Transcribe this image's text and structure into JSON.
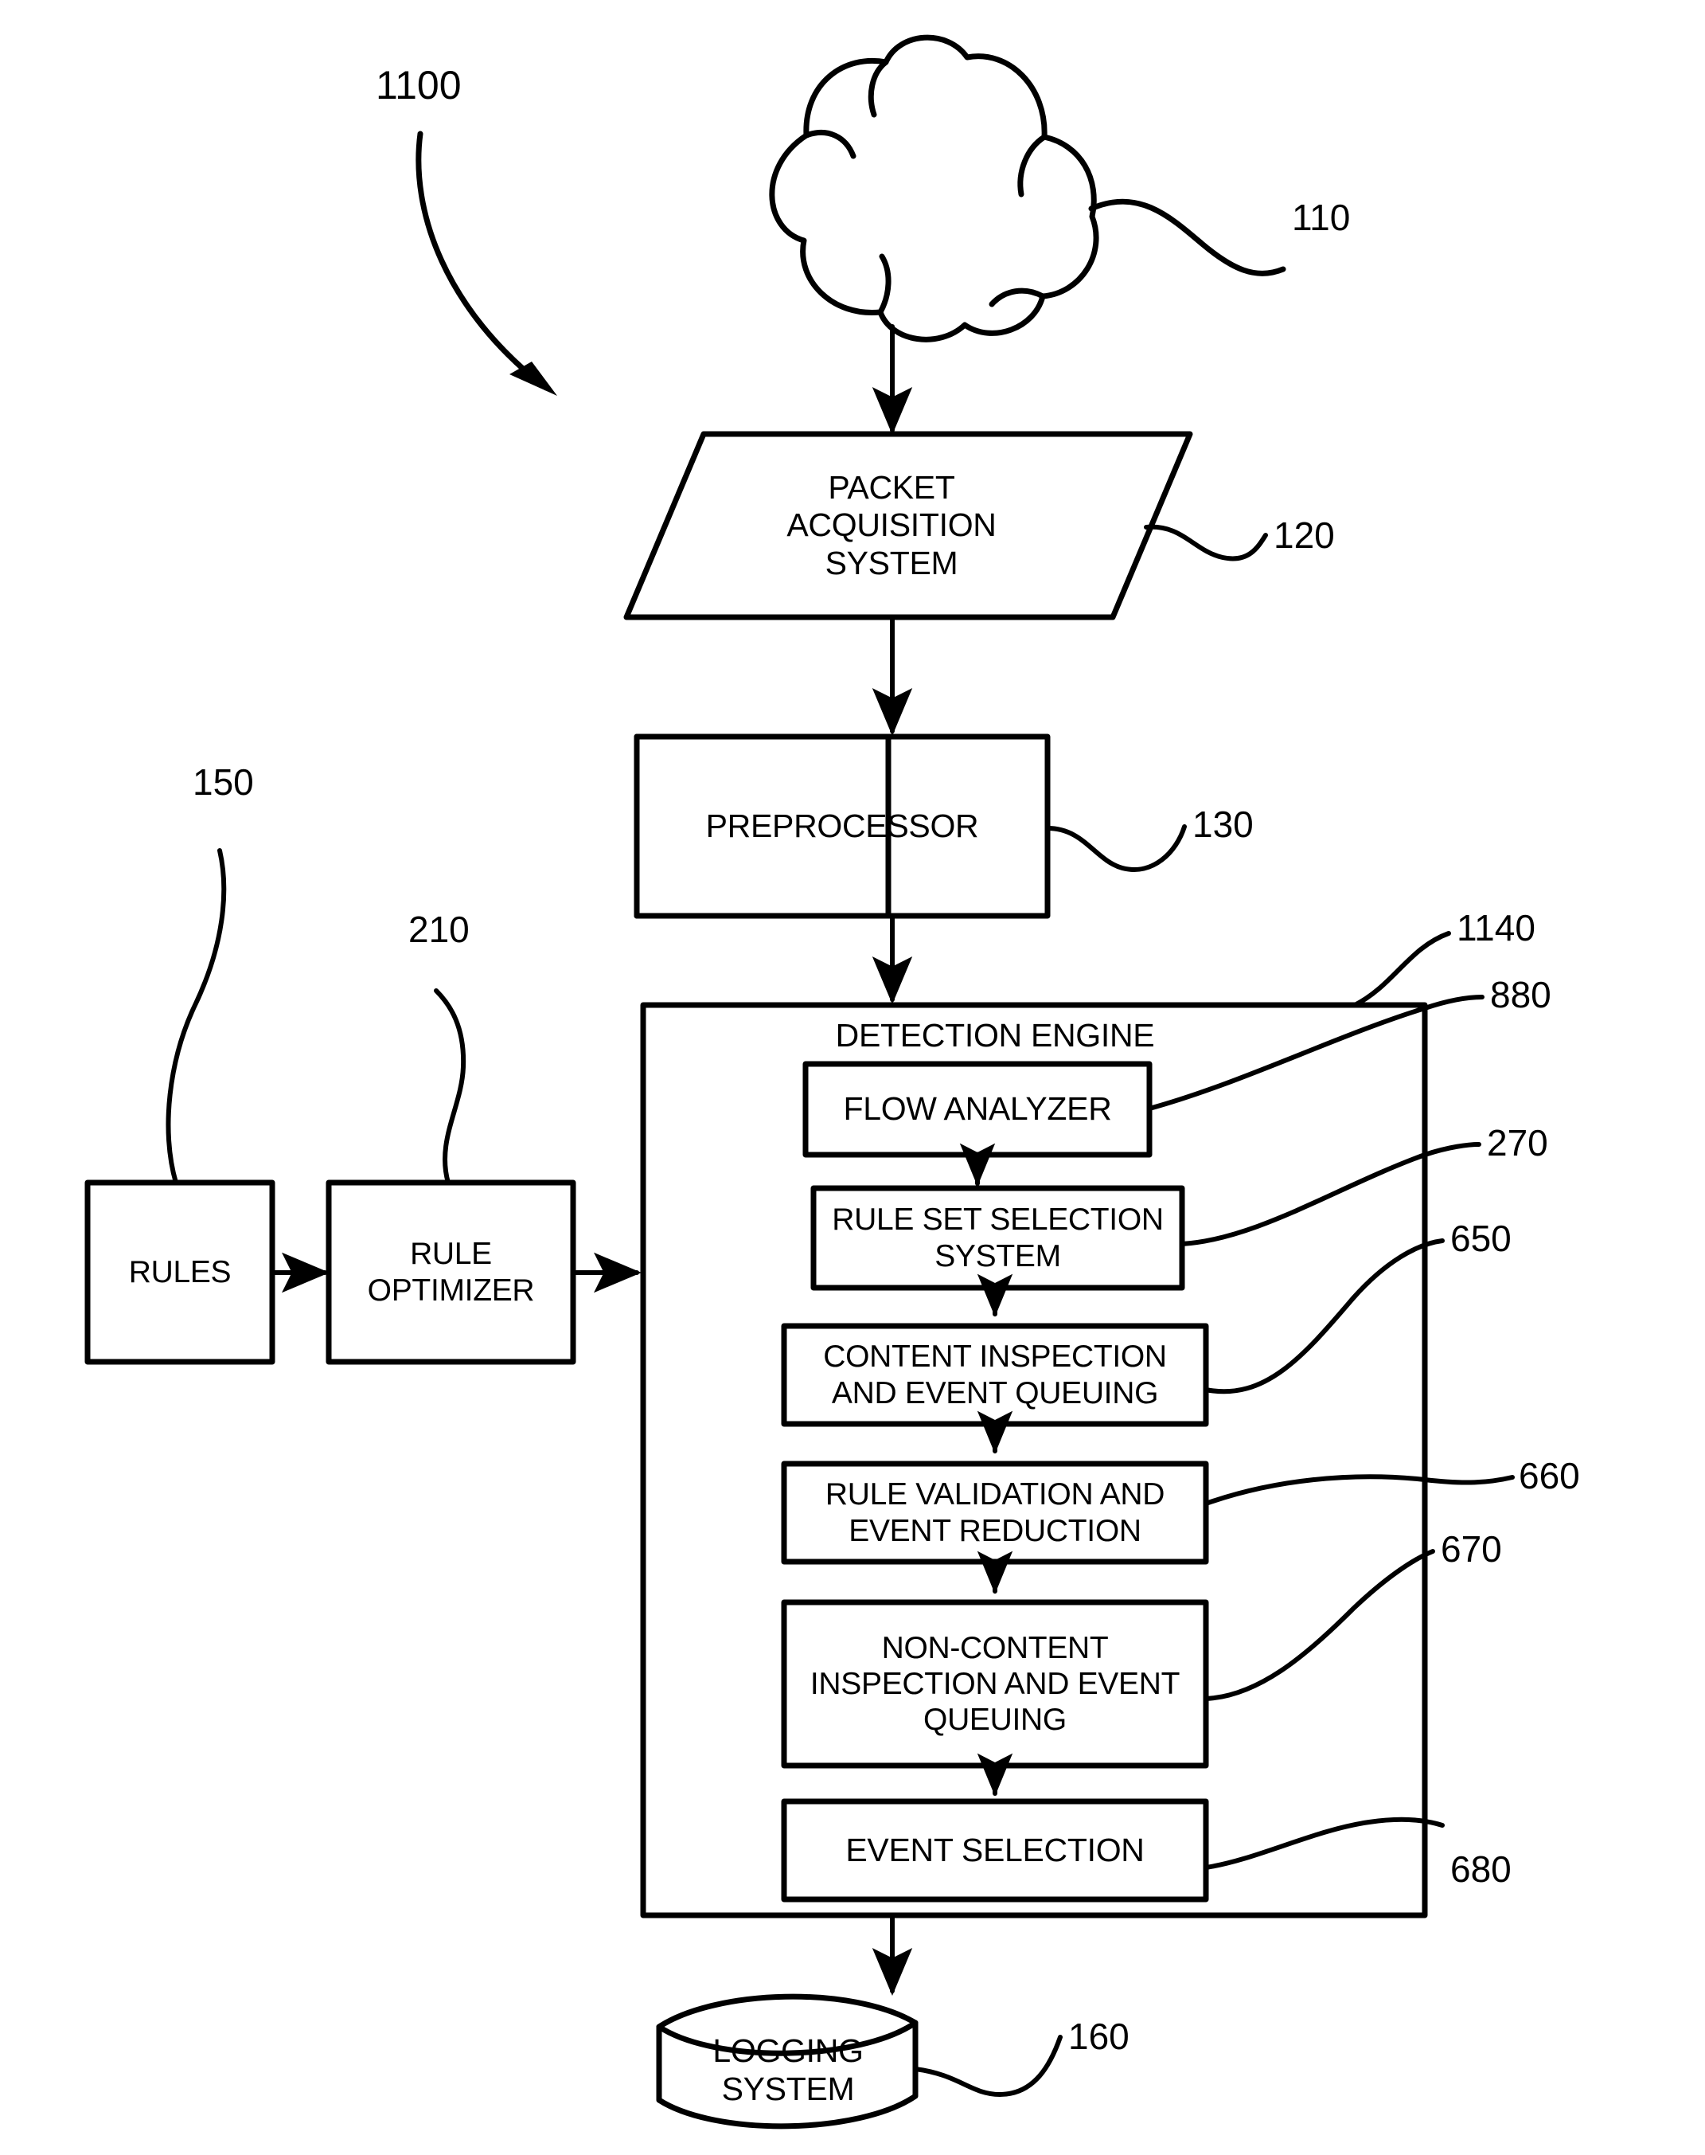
{
  "figure": {
    "title": "1100",
    "kind": "network-intrusion-detection-block-diagram"
  },
  "nodes": {
    "network_cloud": {
      "label": "",
      "ref": "110",
      "shape": "cloud"
    },
    "packet_acquisition": {
      "label": "PACKET\nACQUISITION\nSYSTEM",
      "ref": "120",
      "shape": "parallelogram"
    },
    "preprocessor": {
      "label": "PREPROCESSOR",
      "ref": "130",
      "shape": "rectangle"
    },
    "detection_engine": {
      "label": "DETECTION ENGINE",
      "ref": "1140",
      "shape": "rectangle"
    },
    "flow_analyzer": {
      "label": "FLOW ANALYZER",
      "ref": "880",
      "shape": "rectangle"
    },
    "rule_set_selection": {
      "label": "RULE SET SELECTION\nSYSTEM",
      "ref": "270",
      "shape": "rectangle"
    },
    "content_inspection": {
      "label": "CONTENT INSPECTION\nAND EVENT QUEUING",
      "ref": "650",
      "shape": "rectangle"
    },
    "rule_validation": {
      "label": "RULE VALIDATION AND\nEVENT REDUCTION",
      "ref": "660",
      "shape": "rectangle"
    },
    "non_content_inspection": {
      "label": "NON-CONTENT\nINSPECTION AND EVENT\nQUEUING",
      "ref": "670",
      "shape": "rectangle"
    },
    "event_selection": {
      "label": "EVENT SELECTION",
      "ref": "680",
      "shape": "rectangle"
    },
    "rules": {
      "label": "RULES",
      "ref": "150",
      "shape": "rectangle"
    },
    "rule_optimizer": {
      "label": "RULE\nOPTIMIZER",
      "ref": "210",
      "shape": "rectangle"
    },
    "logging_system": {
      "label": "LOGGING SYSTEM",
      "ref": "160",
      "shape": "cylinder"
    }
  },
  "style": {
    "stroke": "#000000",
    "fill": "#ffffff",
    "background": "#ffffff"
  }
}
